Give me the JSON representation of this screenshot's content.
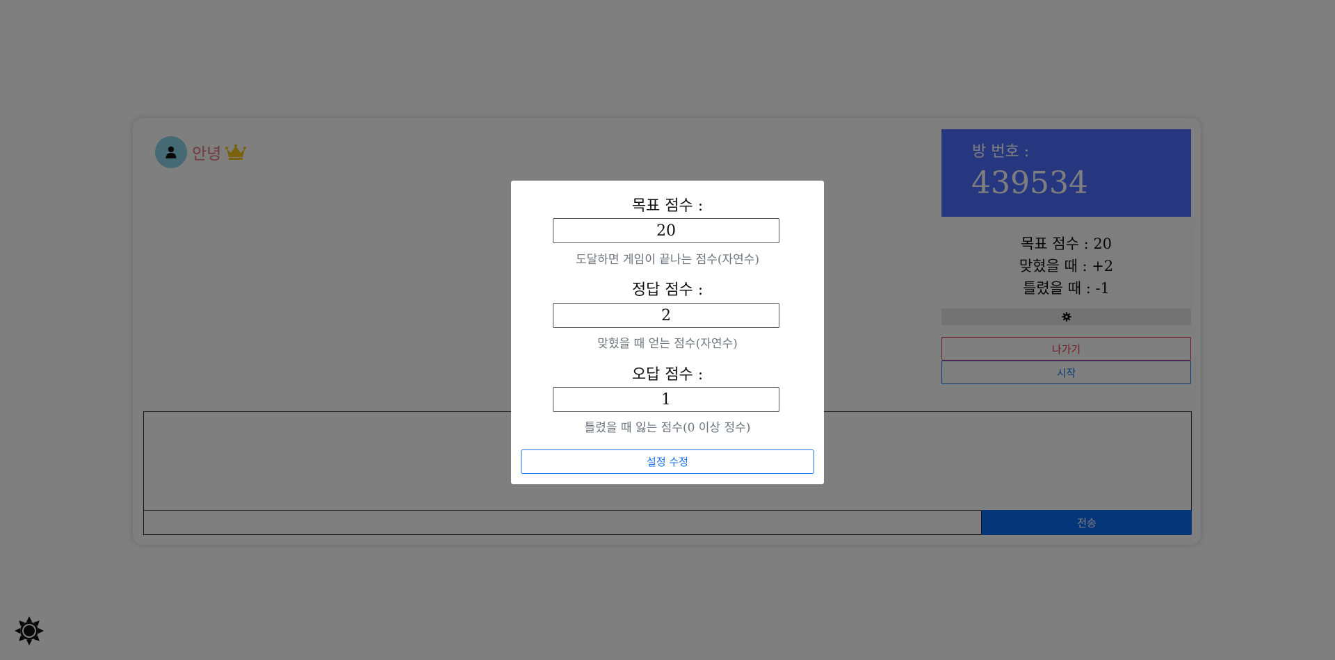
{
  "player": {
    "name": "안녕",
    "avatar_icon": "user-icon",
    "host_icon": "crown-icon"
  },
  "room": {
    "label": "방 번호 :",
    "number": "439534"
  },
  "summary": {
    "target_line": "목표 점수 : 20",
    "correct_line": "맞혔을 때 : +2",
    "wrong_line": "틀렸을 때 : -1",
    "settings_icon": "gear-icon"
  },
  "buttons": {
    "leave": "나가기",
    "start": "시작"
  },
  "chat": {
    "input_value": "",
    "send_label": "전송"
  },
  "theme_toggle_icon": "sun-icon",
  "settings_modal": {
    "target": {
      "label": "목표 점수 :",
      "value": "20",
      "help": "도달하면 게임이 끝나는 점수(자연수)"
    },
    "correct": {
      "label": "정답 점수 :",
      "value": "2",
      "help": "맞혔을 때 얻는 점수(자연수)"
    },
    "wrong": {
      "label": "오답 점수 :",
      "value": "1",
      "help": "틀렸을 때 잃는 점수(0 이상 정수)"
    },
    "submit_label": "설정 수정"
  },
  "colors": {
    "room_box": "#4d6dff",
    "player_name": "#e0707c",
    "leave": "#e23a4a",
    "primary": "#1a73e8",
    "send": "#0a6cf5"
  }
}
